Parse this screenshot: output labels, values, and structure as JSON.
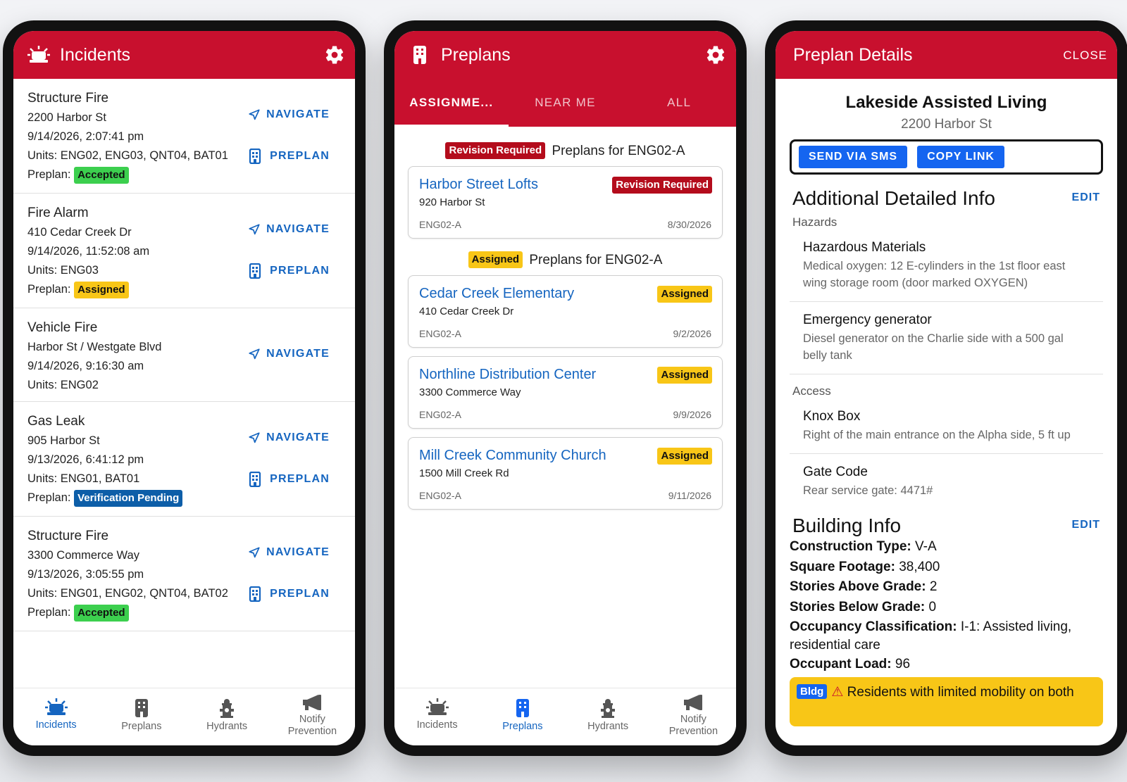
{
  "colors": {
    "brand_red": "#c8102e",
    "link_blue": "#1565c0",
    "accepted": "#3ccf4e",
    "assigned": "#f8c617",
    "pending": "#0d5ea8",
    "revision": "#b40c1c"
  },
  "incidents_screen": {
    "title": "Incidents",
    "navigate_label": "NAVIGATE",
    "preplan_label": "PREPLAN",
    "preplan_prefix": "Preplan:",
    "items": [
      {
        "type": "Structure Fire",
        "address": "2200 Harbor St",
        "time": "9/14/2026, 2:07:41 pm",
        "units": "Units: ENG02, ENG03, QNT04, BAT01",
        "status": "Accepted"
      },
      {
        "type": "Fire Alarm",
        "address": "410 Cedar Creek Dr",
        "time": "9/14/2026, 11:52:08 am",
        "units": "Units: ENG03",
        "status": "Assigned"
      },
      {
        "type": "Vehicle Fire",
        "address": "Harbor St / Westgate Blvd",
        "time": "9/14/2026, 9:16:30 am",
        "units": "Units: ENG02"
      },
      {
        "type": "Gas Leak",
        "address": "905 Harbor St",
        "time": "9/13/2026, 6:41:12 pm",
        "units": "Units: ENG01, BAT01",
        "status": "Verification Pending"
      },
      {
        "type": "Structure Fire",
        "address": "3300 Commerce Way",
        "time": "9/13/2026, 3:05:55 pm",
        "units": "Units: ENG01, ENG02, QNT04, BAT02",
        "status": "Accepted"
      }
    ]
  },
  "bottom_nav": {
    "incidents": "Incidents",
    "preplans": "Preplans",
    "hydrants": "Hydrants",
    "notify_line1": "Notify",
    "notify_line2": "Prevention"
  },
  "preplans_screen": {
    "title": "Preplans",
    "tabs": [
      "ASSIGNME...",
      "NEAR ME",
      "ALL"
    ],
    "revision_section": {
      "badge": "Revision Required",
      "label": "Preplans for ENG02-A"
    },
    "assigned_section": {
      "badge": "Assigned",
      "label": "Preplans for ENG02-A"
    },
    "revision_cards": [
      {
        "name": "Harbor Street Lofts",
        "address": "920 Harbor St",
        "unit": "ENG02-A",
        "date": "8/30/2026",
        "status": "Revision Required"
      }
    ],
    "assigned_cards": [
      {
        "name": "Cedar Creek Elementary",
        "address": "410 Cedar Creek Dr",
        "unit": "ENG02-A",
        "date": "9/2/2026",
        "status": "Assigned"
      },
      {
        "name": "Northline Distribution Center",
        "address": "3300 Commerce Way",
        "unit": "ENG02-A",
        "date": "9/9/2026",
        "status": "Assigned"
      },
      {
        "name": "Mill Creek Community Church",
        "address": "1500 Mill Creek Rd",
        "unit": "ENG02-A",
        "date": "9/11/2026",
        "status": "Assigned"
      }
    ]
  },
  "details_screen": {
    "title": "Preplan Details",
    "close_label": "CLOSE",
    "name": "Lakeside Assisted Living",
    "address": "2200 Harbor St",
    "send_sms_label": "SEND VIA SMS",
    "copy_link_label": "COPY LINK",
    "additional_title": "Additional Detailed Info",
    "edit_label": "EDIT",
    "hazards_label": "Hazards",
    "hazards": [
      {
        "key": "Hazardous Materials",
        "value": "Medical oxygen: 12 E-cylinders in the 1st floor east wing storage room (door marked OXYGEN)"
      },
      {
        "key": "Emergency generator",
        "value": "Diesel generator on the Charlie side with a 500 gal belly tank"
      }
    ],
    "access_label": "Access",
    "access": [
      {
        "key": "Knox Box",
        "value": "Right of the main entrance on the Alpha side, 5 ft up"
      },
      {
        "key": "Gate Code",
        "value": "Rear service gate: 4471#"
      }
    ],
    "building_title": "Building Info",
    "building": [
      {
        "k": "Construction Type:",
        "v": "V-A"
      },
      {
        "k": "Square Footage:",
        "v": "38,400"
      },
      {
        "k": "Stories Above Grade:",
        "v": "2"
      },
      {
        "k": "Stories Below Grade:",
        "v": "0"
      },
      {
        "k": "Occupancy Classification:",
        "v": "I-1: Assisted living, residential care"
      },
      {
        "k": "Occupant Load:",
        "v": "96"
      }
    ],
    "alert_tag": "Bldg",
    "alert_text": "Residents with limited mobility on both"
  }
}
